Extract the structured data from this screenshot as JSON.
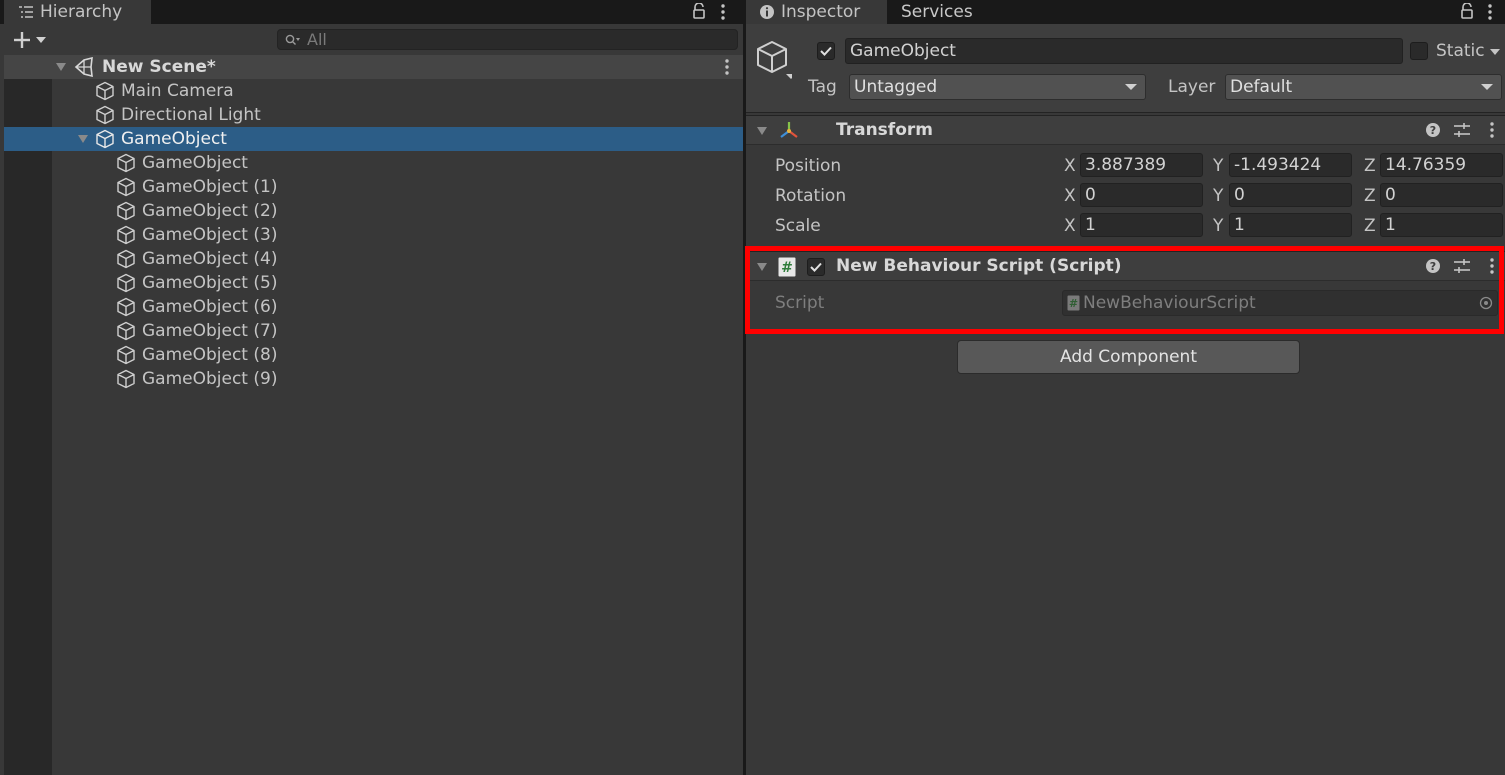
{
  "hierarchy": {
    "tab_label": "Hierarchy",
    "search_placeholder": "All",
    "scene": {
      "label": "New Scene*"
    },
    "items": [
      {
        "label": "Main Camera"
      },
      {
        "label": "Directional Light"
      },
      {
        "label": "GameObject",
        "selected": true,
        "expanded": true,
        "children": [
          {
            "label": "GameObject"
          },
          {
            "label": "GameObject (1)"
          },
          {
            "label": "GameObject (2)"
          },
          {
            "label": "GameObject (3)"
          },
          {
            "label": "GameObject (4)"
          },
          {
            "label": "GameObject (5)"
          },
          {
            "label": "GameObject (6)"
          },
          {
            "label": "GameObject (7)"
          },
          {
            "label": "GameObject (8)"
          },
          {
            "label": "GameObject (9)"
          }
        ]
      }
    ]
  },
  "inspector": {
    "tabs": [
      {
        "label": "Inspector"
      },
      {
        "label": "Services"
      }
    ],
    "object": {
      "name": "GameObject",
      "active": true,
      "static_label": "Static",
      "static_checked": false,
      "tag_label": "Tag",
      "tag_value": "Untagged",
      "layer_label": "Layer",
      "layer_value": "Default"
    },
    "transform": {
      "title": "Transform",
      "position": {
        "label": "Position",
        "x": "3.887389",
        "y": "-1.493424",
        "z": "14.76359"
      },
      "rotation": {
        "label": "Rotation",
        "x": "0",
        "y": "0",
        "z": "0"
      },
      "scale": {
        "label": "Scale",
        "x": "1",
        "y": "1",
        "z": "1"
      }
    },
    "script_component": {
      "title": "New Behaviour Script (Script)",
      "enabled": true,
      "script_label": "Script",
      "script_value": "NewBehaviourScript"
    },
    "add_component_label": "Add Component"
  },
  "axis_labels": {
    "x": "X",
    "y": "Y",
    "z": "Z"
  },
  "colors": {
    "selection": "#2c5d87",
    "highlight": "#ff0000",
    "panel_bg": "#383838"
  }
}
